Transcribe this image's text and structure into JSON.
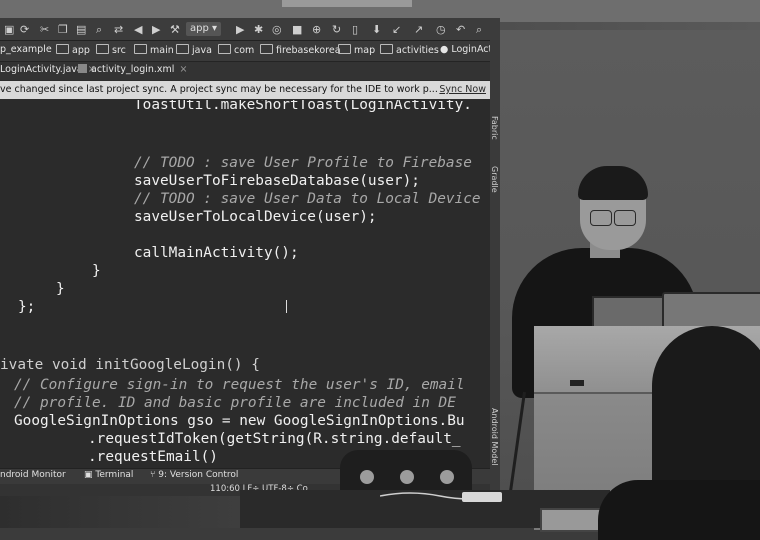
{
  "ide": {
    "run_config": "app",
    "breadcrumb": [
      "p_example",
      "app",
      "src",
      "main",
      "java",
      "com",
      "firebasekorea",
      "map",
      "activities",
      "LoginActivity"
    ],
    "tabs": [
      "LoginActivity.java",
      "activity_login.xml"
    ],
    "sync_message": "ve changed since last project sync. A project sync may be necessary for the IDE to work p...",
    "sync_link": "Sync Now",
    "side_tabs": [
      "Fabric",
      "Gradle",
      "Android Model"
    ],
    "code_lines": [
      {
        "text": "ToastUtil.makeShortToast(LoginActivity.",
        "kind": "code"
      },
      {
        "text": "// TODO : save User Profile to Firebase",
        "kind": "comment"
      },
      {
        "text": "saveUserToFirebaseDatabase(user);",
        "kind": "code"
      },
      {
        "text": "// TODO : save User Data to Local Device",
        "kind": "comment"
      },
      {
        "text": "saveUserToLocalDevice(user);",
        "kind": "code"
      },
      {
        "text": "callMainActivity();",
        "kind": "code"
      },
      {
        "text": "}",
        "kind": "code"
      },
      {
        "text": "}",
        "kind": "code"
      },
      {
        "text": "};",
        "kind": "code"
      },
      {
        "text": "ivate void initGoogleLogin() {",
        "kind": "code"
      },
      {
        "text": "// Configure sign-in to request the user's ID, email",
        "kind": "comment"
      },
      {
        "text": "// profile. ID and basic profile are included in DE",
        "kind": "comment"
      },
      {
        "text": "GoogleSignInOptions gso = new GoogleSignInOptions.Bu",
        "kind": "code"
      },
      {
        "text": ".requestIdToken(getString(R.string.default_",
        "kind": "code"
      },
      {
        "text": ".requestEmail()",
        "kind": "code"
      }
    ],
    "bottom_tabs": [
      "ndroid Monitor",
      "Terminal",
      "9: Version Control"
    ],
    "status": "110:60  LF÷  UTF-8÷  Co"
  }
}
